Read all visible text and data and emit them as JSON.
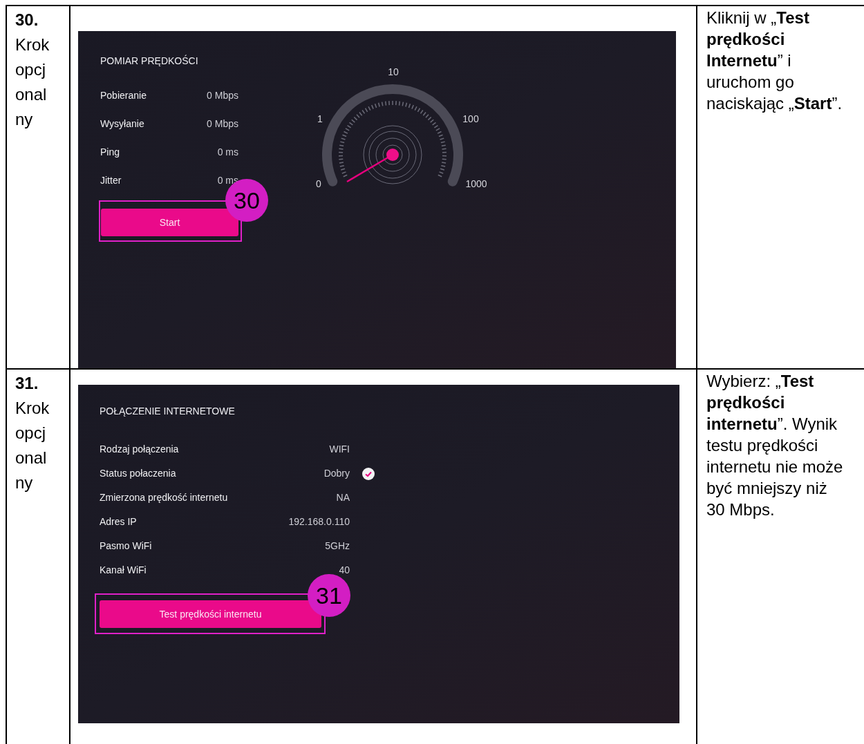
{
  "steps": [
    {
      "number": "30.",
      "label": "Krok opcjonalny",
      "screen": {
        "kind": "speed_test",
        "title": "POMIAR PRĘDKOŚCI",
        "rows": [
          {
            "label": "Pobieranie",
            "value": "0 Mbps",
            "check": false
          },
          {
            "label": "Wysyłanie",
            "value": "0 Mbps",
            "check": false
          },
          {
            "label": "Ping",
            "value": "0 ms",
            "check": false
          },
          {
            "label": "Jitter",
            "value": "0 ms",
            "check": false
          }
        ],
        "button": "Start",
        "callout": "30",
        "gauge_labels": [
          "10",
          "1",
          "100",
          "0",
          "1000"
        ]
      },
      "instruction": "Kliknij w „**Test prędkości Internetu**” i uruchom go naciskając „**Start**”."
    },
    {
      "number": "31.",
      "label": "Krok opcjonalny",
      "screen": {
        "kind": "connection",
        "title": "POŁĄCZENIE INTERNETOWE",
        "rows": [
          {
            "label": "Rodzaj połączenia",
            "value": "WIFI",
            "check": false
          },
          {
            "label": "Status połaczenia",
            "value": "Dobry",
            "check": true
          },
          {
            "label": "Zmierzona prędkość internetu",
            "value": "NA",
            "check": false
          },
          {
            "label": "Adres IP",
            "value": "192.168.0.110",
            "check": false
          },
          {
            "label": "Pasmo WiFi",
            "value": "5GHz",
            "check": false
          },
          {
            "label": "Kanał WiFi",
            "value": "40",
            "check": false
          }
        ],
        "button": "Test prędkości internetu",
        "callout": "31"
      },
      "instruction": "Wybierz: „**Test prędkości internetu**”. Wynik testu prędkości internetu nie może być mniejszy niż 30 Mbps."
    }
  ]
}
